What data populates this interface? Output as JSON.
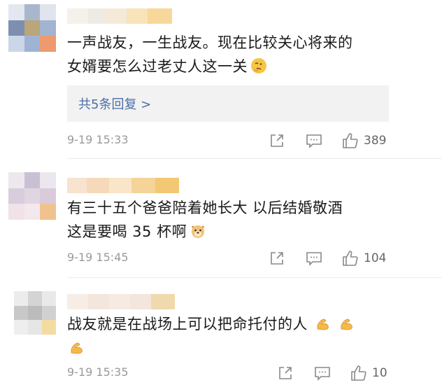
{
  "comments": [
    {
      "text_line1": "一声战友，一生战友。现在比较关心将来的",
      "text_line2": "女婿要怎么过老丈人这一关",
      "emoji": "thinking-emoji",
      "reply_link": "共5条回复 >",
      "time": "9-19 15:33",
      "likes": "389"
    },
    {
      "text_line1": "有三十五个爸爸陪着她长大 以后结婚敬酒",
      "text_line2": "这是要喝 35 杯啊",
      "emoji": "doge-emoji",
      "time": "9-19 15:45",
      "likes": "104"
    },
    {
      "text_line1": "战友就是在战场上可以把命托付的人",
      "text_line2": "",
      "emoji": "flexed-biceps-emoji",
      "time": "9-19 15:35",
      "likes": "10"
    }
  ],
  "colors": {
    "link": "#4a6fa5",
    "meta": "#9a9a9a",
    "reply_bg": "#f2f2f2"
  }
}
